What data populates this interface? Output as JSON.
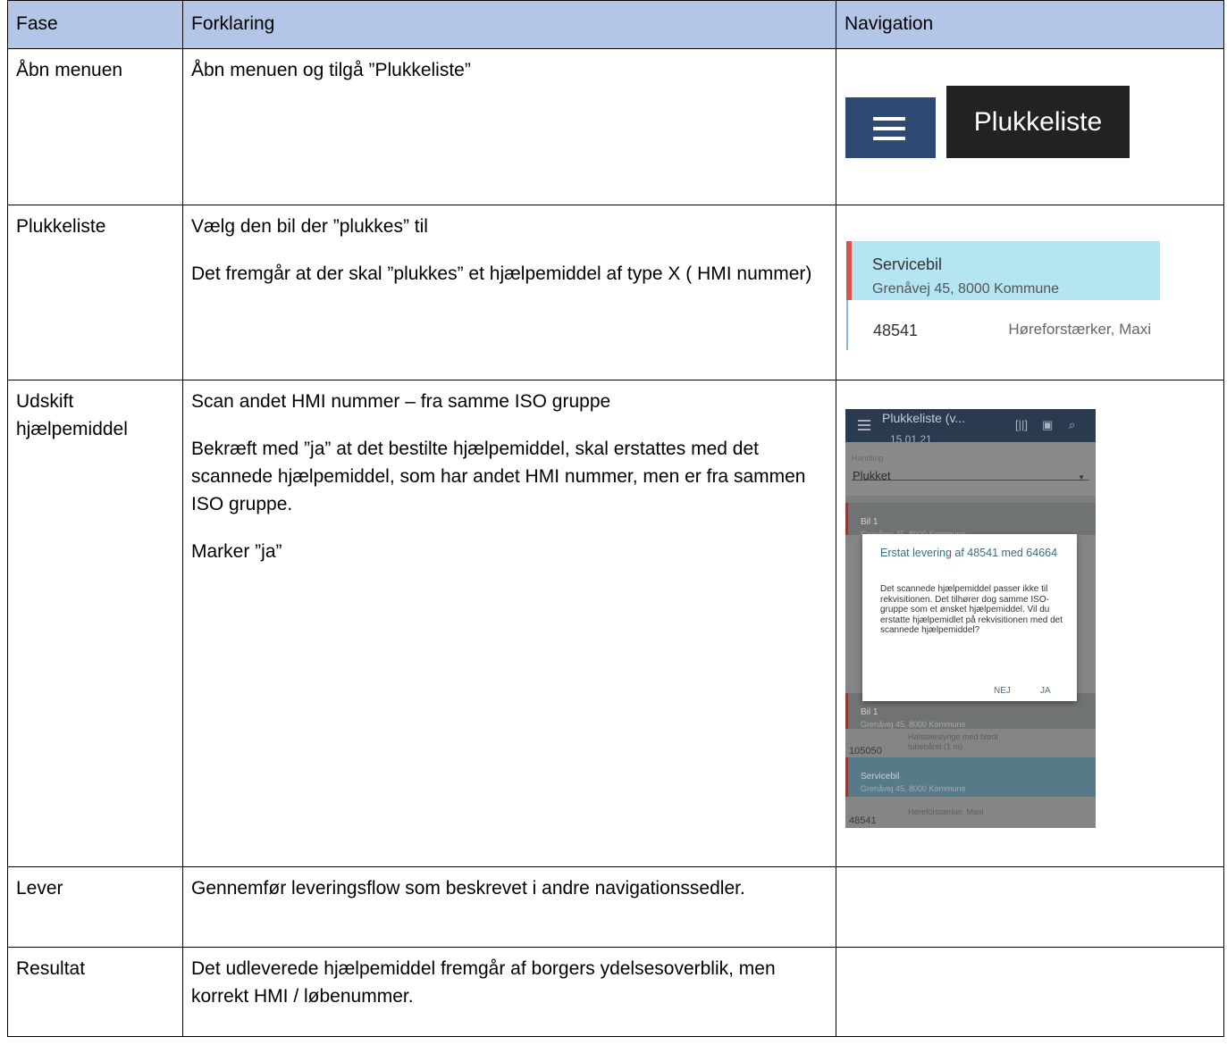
{
  "headers": {
    "fase": "Fase",
    "forklaring": "Forklaring",
    "navigation": "Navigation"
  },
  "rows": [
    {
      "fase": "Åbn menuen",
      "forklaring": [
        "Åbn menuen og tilgå ”Plukkeliste”"
      ]
    },
    {
      "fase": "Plukkeliste",
      "forklaring": [
        "Vælg den bil der ”plukkes” til",
        "Det fremgår at der skal ”plukkes” et hjælpemiddel af type X ( HMI nummer)"
      ]
    },
    {
      "fase": "Udskift hjælpemiddel",
      "forklaring": [
        "Scan andet HMI nummer – fra samme ISO gruppe",
        "Bekræft med ”ja” at det bestilte hjælpemiddel, skal erstattes med det scannede hjælpemiddel, som har andet HMI nummer, men er fra sammen ISO gruppe.",
        "Marker ”ja”"
      ]
    },
    {
      "fase": "Lever",
      "forklaring": [
        "Gennemfør leveringsflow som beskrevet i andre navigationssedler."
      ]
    },
    {
      "fase": "Resultat",
      "forklaring": [
        "Det udleverede hjælpemiddel fremgår af borgers ydelsesoverblik, men korrekt HMI / løbenummer."
      ]
    }
  ],
  "nav1": {
    "menu_icon": "hamburger-menu-icon",
    "plukkeliste_label": "Plukkeliste",
    "menu_color": "#2e4a72"
  },
  "nav2": {
    "title": "Servicebil",
    "address": "Grenåvej 45, 8000 Kommune",
    "number": "48541",
    "item": "Høreforstærker, Maxi"
  },
  "phone": {
    "title": "Plukkeliste (v...",
    "date": "15.01.21",
    "filter_label": "Handling",
    "filter_value": "Plukket",
    "group1_title": "Bil 1",
    "group1_addr": "Grenåvej 45, 8000 Kommune",
    "group2_title": "Bil 1",
    "group2_addr": "Grenåvej 45, 8000 Kommune",
    "line1_num": "105050",
    "line1_item": "Halsteleslynge med blødt tubebånd (1 m)",
    "svc_title": "Servicebil",
    "svc_addr": "Grenåvej 45, 8000 Kommune",
    "line2_num": "48541",
    "line2_item": "Høreforstærker, Maxi",
    "dialog_title": "Erstat levering af 48541 med 64664",
    "dialog_body": "Det scannede hjælpemiddel passer ikke til rekvisitionen. Det tilhører dog samme ISO-gruppe som et ønsket hjælpemiddel. Vil du erstatte hjælpemidlet på rekvisitionen med det scannede hjælpemiddel?",
    "no_label": "NEJ",
    "yes_label": "JA"
  },
  "colors": {
    "header_bg": "#b4c6e7",
    "card_bg": "#b5e4f2",
    "accent_red": "#d9534f"
  }
}
